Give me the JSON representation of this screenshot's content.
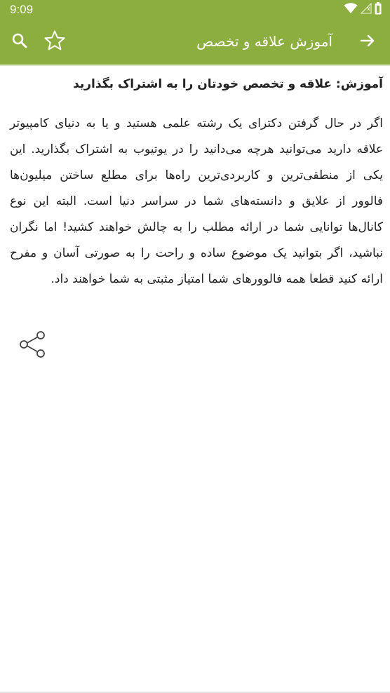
{
  "status_bar": {
    "time": "9:09",
    "icons": [
      "wifi-icon",
      "signal-icon",
      "battery-icon"
    ]
  },
  "app_bar": {
    "title": "آموزش علاقه و تخصص",
    "icons": [
      "back-arrow-icon",
      "star-icon",
      "search-icon"
    ]
  },
  "article": {
    "heading": "آموزش: علاقه و تخصص خودتان را به اشتراک بگذارید",
    "body": "اگر در حال گرفتن دکترای یک رشته علمی هستید و یا به دنیای کامپیوتر علاقه دارید می‌توانید هرچه می‌دانید را در یوتیوب به اشتراک بگذارید. این یکی از منطقی‌ترین و کاربردی‌ترین راه‌ها برای مطلع ساختن میلیون‌ها فالوور از علایق و دانسته‌های شما در سراسر دنیا است. البته این نوع کانال‌ها توانایی شما در ارائه مطلب را به چالش خواهند کشید! اما نگران نباشید، اگر بتوانید یک موضوع ساده و راحت را به صورتی آسان و مفرح ارائه کنید قطعا همه فالوورهای شما امتیاز مثبتی به شما خواهند داد."
  },
  "actions": {
    "share_icon": "share-icon"
  },
  "colors": {
    "primary": "#8bae3f",
    "on_primary": "#ffffff",
    "text": "#222222",
    "icon_gray": "#444444"
  }
}
